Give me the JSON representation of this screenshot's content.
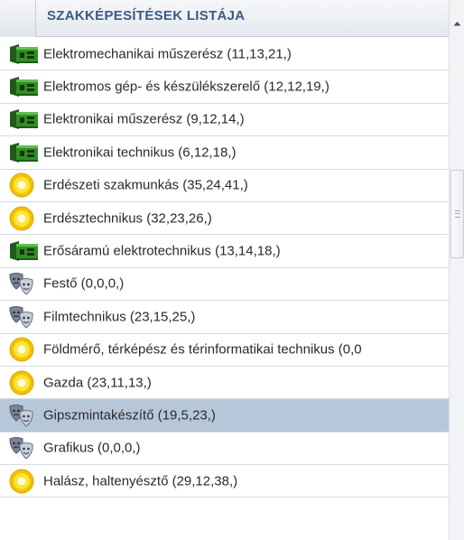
{
  "header": {
    "title": "SZAKKÉPESÍTÉSEK LISTÁJA"
  },
  "colors": {
    "selected_row": "#b7c7da",
    "header_text": "#3a5a86"
  },
  "items": [
    {
      "label": "Elektromechanikai műszerész (11,13,21,)",
      "icon": "circuit-board-icon"
    },
    {
      "label": "Elektromos gép- és készülékszerelő (12,12,19,)",
      "icon": "circuit-board-icon"
    },
    {
      "label": "Elektronikai műszerész (9,12,14,)",
      "icon": "circuit-board-icon"
    },
    {
      "label": "Elektronikai technikus (6,12,18,)",
      "icon": "circuit-board-icon"
    },
    {
      "label": "Erdészeti szakmunkás (35,24,41,)",
      "icon": "sun-icon"
    },
    {
      "label": "Erdésztechnikus (32,23,26,)",
      "icon": "sun-icon"
    },
    {
      "label": "Erősáramú elektrotechnikus (13,14,18,)",
      "icon": "circuit-board-icon"
    },
    {
      "label": "Festő (0,0,0,)",
      "icon": "theater-masks-icon"
    },
    {
      "label": "Filmtechnikus (23,15,25,)",
      "icon": "theater-masks-icon"
    },
    {
      "label": "Földmérő, térképész és térinformatikai technikus (0,0",
      "icon": "sun-icon"
    },
    {
      "label": "Gazda (23,11,13,)",
      "icon": "sun-icon"
    },
    {
      "label": "Gipszmintakészítő (19,5,23,)",
      "icon": "theater-masks-icon",
      "selected": true
    },
    {
      "label": "Grafikus (0,0,0,)",
      "icon": "theater-masks-icon"
    },
    {
      "label": "Halász, haltenyésztő (29,12,38,)",
      "icon": "sun-icon"
    }
  ]
}
